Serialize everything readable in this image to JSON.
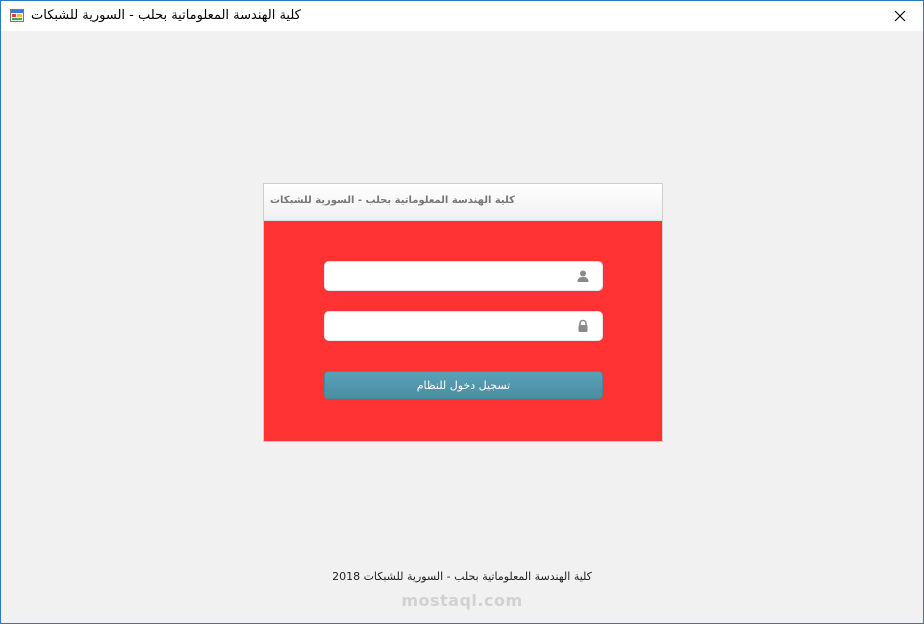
{
  "window": {
    "title": "كلية الهندسة المعلوماتية بحلب - السورية للشبكات",
    "close_icon": "close-icon",
    "app_icon": "app-form-icon"
  },
  "login_panel": {
    "header": "كلية الهندسة المعلوماتية بحلب - السورية للشبكات",
    "username": {
      "value": "",
      "icon": "user-icon"
    },
    "password": {
      "value": "",
      "icon": "lock-icon"
    },
    "submit_label": "تسجيل دخول للنظام",
    "colors": {
      "panel_bg": "#ff3333",
      "button_bg": "#4f93aa"
    }
  },
  "footer": {
    "text": "كلية الهندسة المعلوماتية بحلب - السورية للشبكات",
    "year": "2018"
  },
  "watermark": {
    "text": "mostaql.com"
  }
}
